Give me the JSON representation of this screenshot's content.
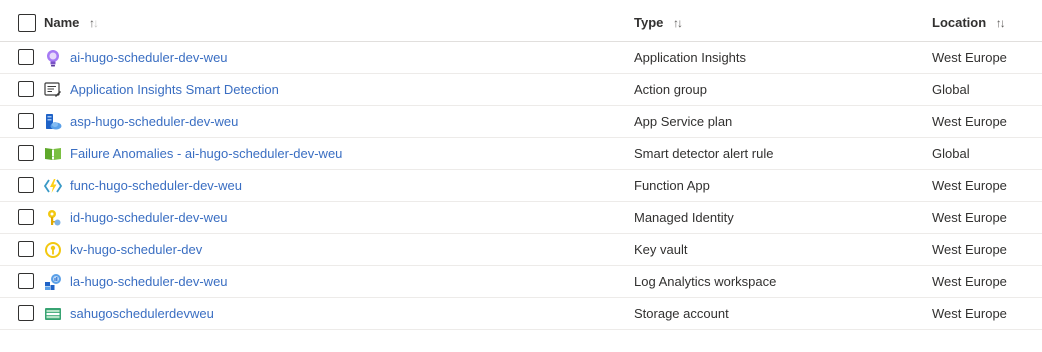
{
  "table": {
    "columns": {
      "name": "Name",
      "type": "Type",
      "location": "Location"
    },
    "rows": [
      {
        "name": "ai-hugo-scheduler-dev-weu",
        "type": "Application Insights",
        "location": "West Europe",
        "icon": "application-insights-icon"
      },
      {
        "name": "Application Insights Smart Detection",
        "type": "Action group",
        "location": "Global",
        "icon": "action-group-icon"
      },
      {
        "name": "asp-hugo-scheduler-dev-weu",
        "type": "App Service plan",
        "location": "West Europe",
        "icon": "app-service-plan-icon"
      },
      {
        "name": "Failure Anomalies - ai-hugo-scheduler-dev-weu",
        "type": "Smart detector alert rule",
        "location": "Global",
        "icon": "smart-detector-icon"
      },
      {
        "name": "func-hugo-scheduler-dev-weu",
        "type": "Function App",
        "location": "West Europe",
        "icon": "function-app-icon"
      },
      {
        "name": "id-hugo-scheduler-dev-weu",
        "type": "Managed Identity",
        "location": "West Europe",
        "icon": "managed-identity-icon"
      },
      {
        "name": "kv-hugo-scheduler-dev",
        "type": "Key vault",
        "location": "West Europe",
        "icon": "key-vault-icon"
      },
      {
        "name": "la-hugo-scheduler-dev-weu",
        "type": "Log Analytics workspace",
        "location": "West Europe",
        "icon": "log-analytics-icon"
      },
      {
        "name": "sahugoschedulerdevweu",
        "type": "Storage account",
        "location": "West Europe",
        "icon": "storage-account-icon"
      }
    ]
  }
}
